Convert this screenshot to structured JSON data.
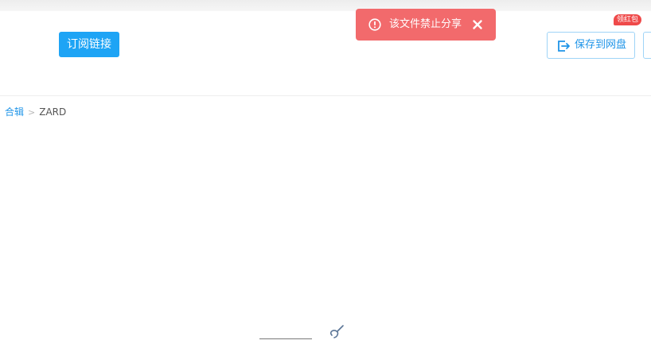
{
  "header": {
    "subscribe_label": "订阅链接",
    "save_label": "保存到网盘",
    "redpacket_badge": "领红包"
  },
  "toast": {
    "message": "该文件禁止分享"
  },
  "breadcrumb": {
    "root": "合辑",
    "separator": ">",
    "current": "ZARD"
  },
  "icons": {
    "toast_warning": "exclamation-circle-icon",
    "toast_close": "close-icon",
    "save": "save-to-drive-icon"
  },
  "colors": {
    "primary": "#1ea4f5",
    "toast_bg": "#f26a6c",
    "badge_bg": "#ef4a4a"
  }
}
